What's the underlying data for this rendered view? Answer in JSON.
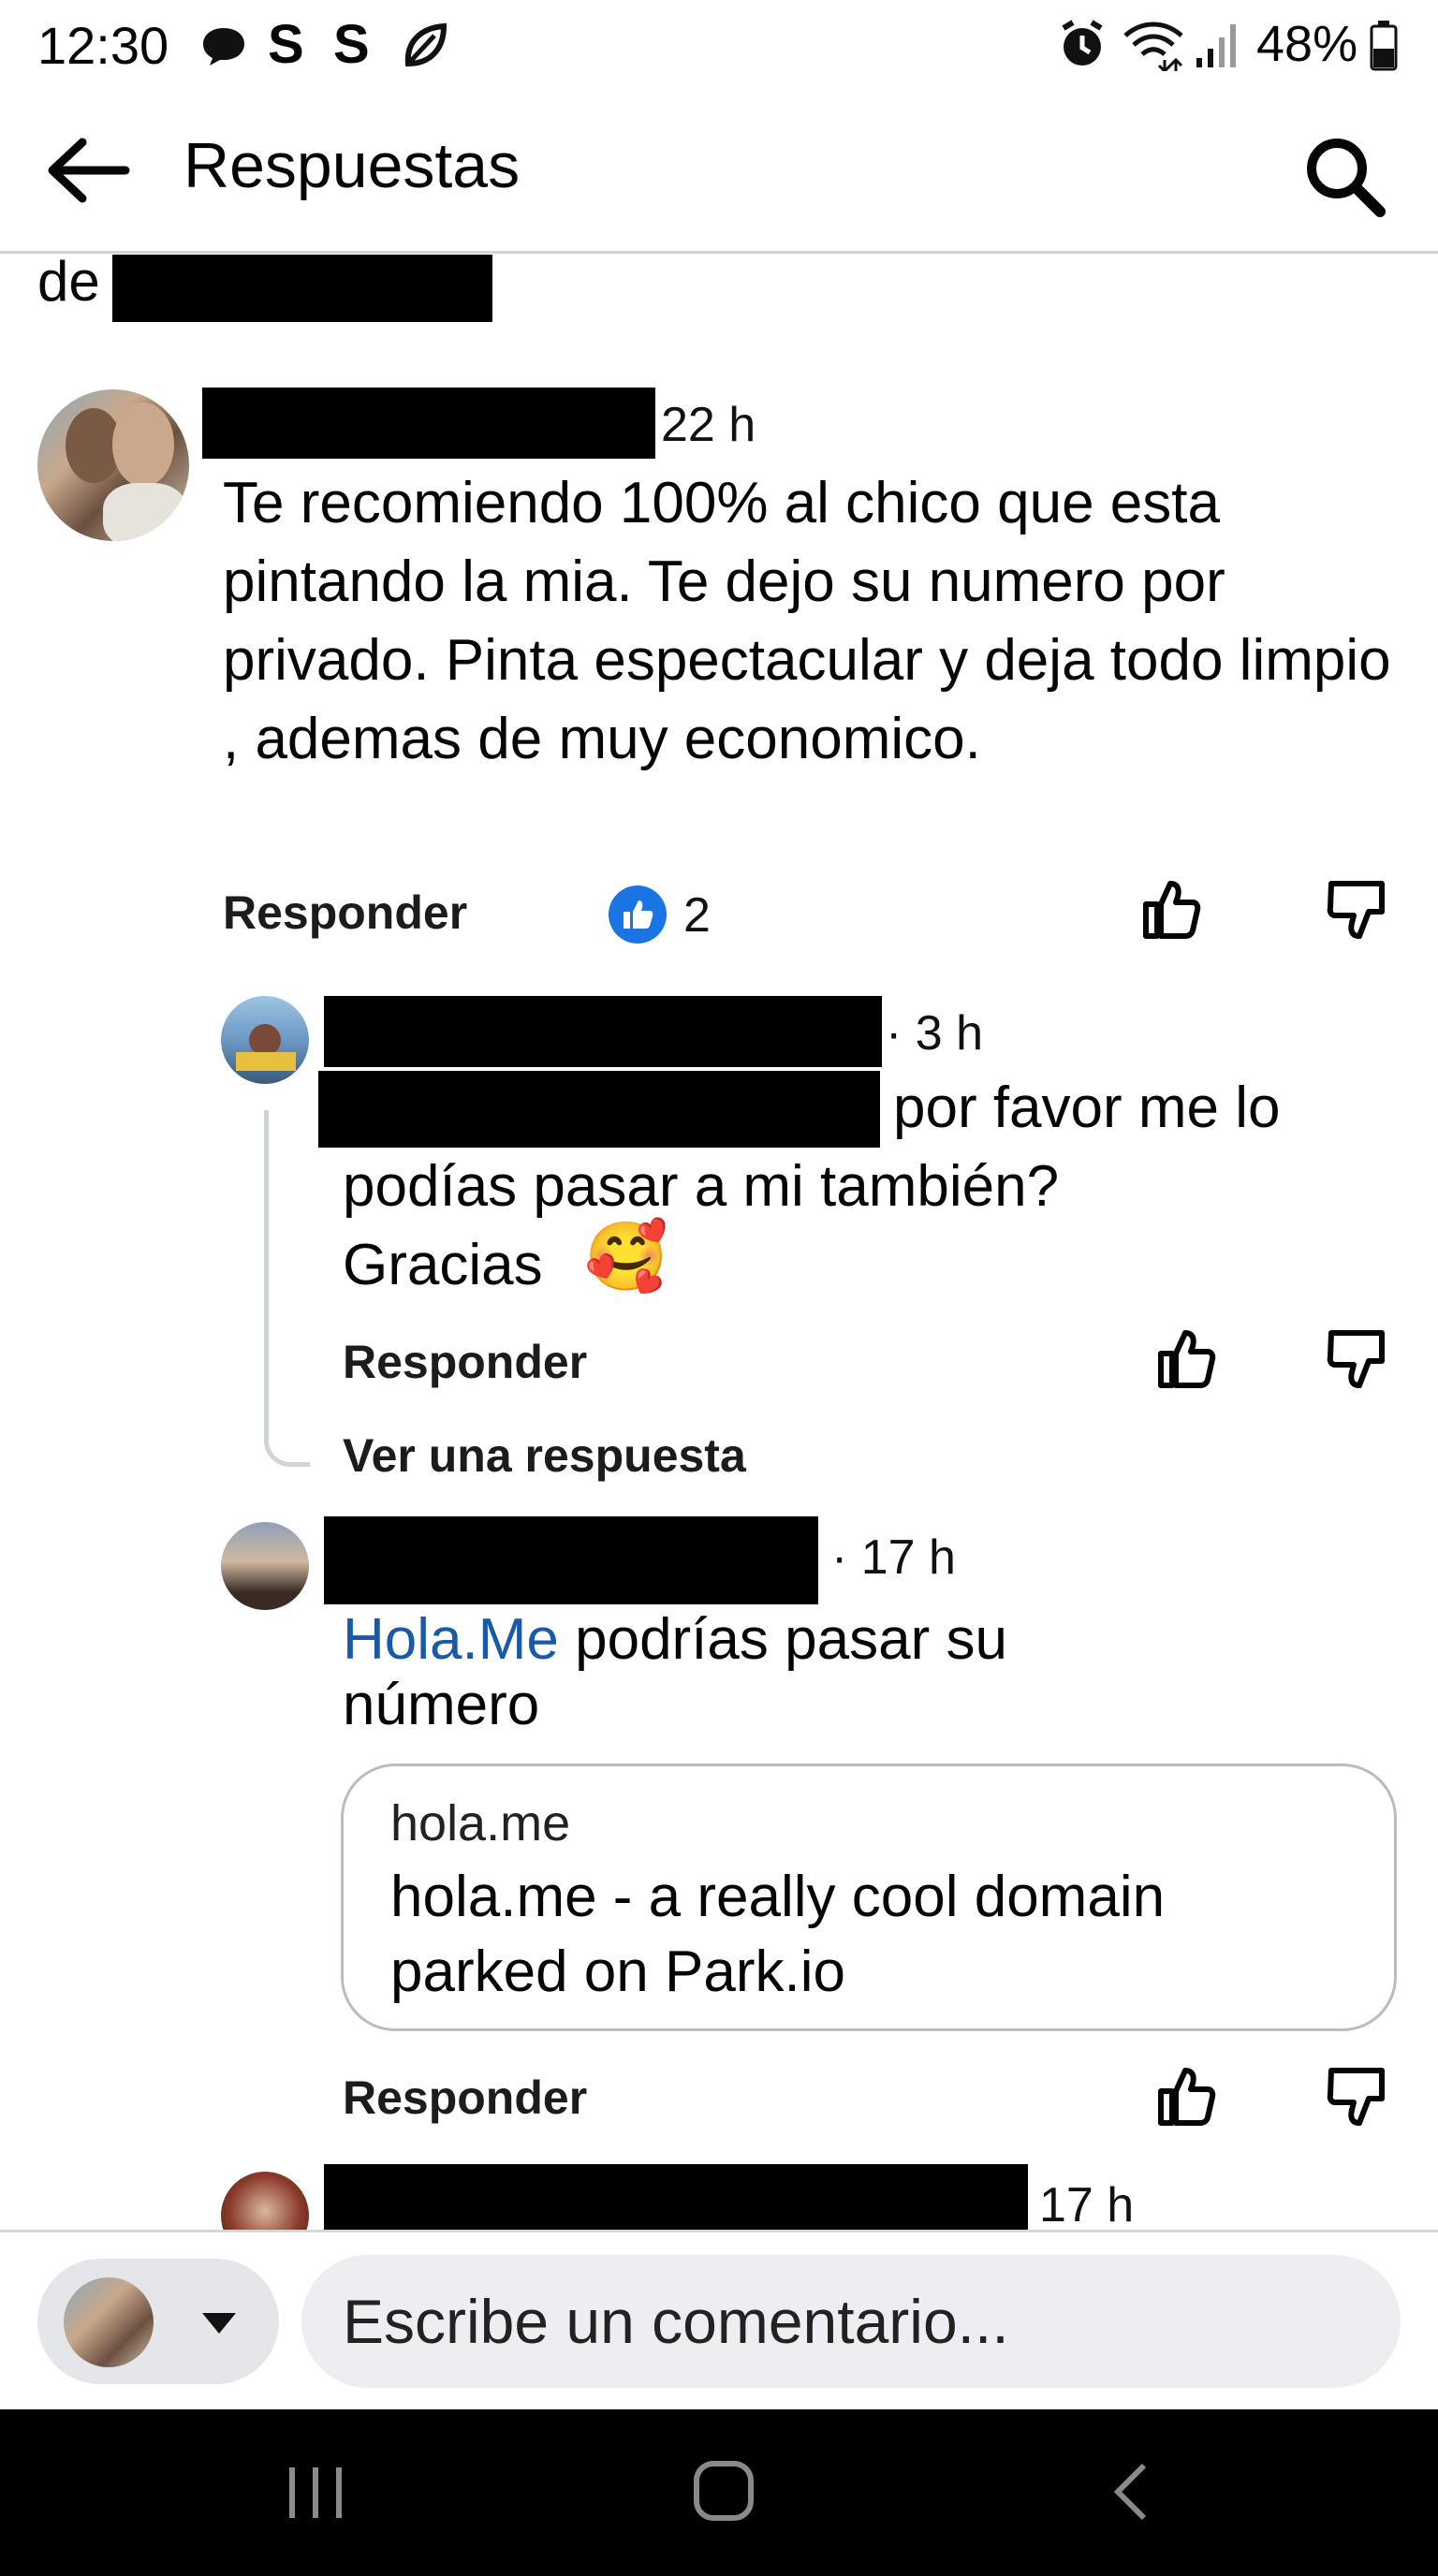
{
  "status_bar": {
    "time": "12:30",
    "icons": [
      "chat-icon",
      "s-icon",
      "s-icon",
      "leaf-icon"
    ],
    "right_icons": [
      "alarm-icon",
      "wifi-icon",
      "signal-icon",
      "battery-icon"
    ],
    "battery_percent": "48%"
  },
  "header": {
    "title": "Respuestas",
    "back_icon": "arrow-left-icon",
    "search_icon": "search-icon"
  },
  "top_fragment": {
    "text": "de"
  },
  "comments": [
    {
      "time": "22 h",
      "text": "Te recomiendo 100% al chico que esta pintando la mia. Te dejo su numero por privado. Pinta espectacular y deja todo limpio , ademas de muy economico.",
      "reply_label": "Responder",
      "reaction_count": "2"
    }
  ],
  "replies": [
    {
      "time": "· 3 h",
      "text_after_redaction": "por favor me lo",
      "text_lines": [
        "podías pasar a mi también?",
        "Gracias"
      ],
      "emoji": "🥰",
      "reply_label": "Responder",
      "view_replies": "Ver una respuesta"
    },
    {
      "time": "· 17 h",
      "mention": "Hola.Me",
      "text": " podrías  pasar  su",
      "text_line2": "número",
      "link_preview": {
        "domain": "hola.me",
        "title_line1": "hola.me - a really cool domain",
        "title_line2": "parked on Park.io"
      },
      "reply_label": "Responder"
    },
    {
      "time": "17 h"
    }
  ],
  "composer": {
    "placeholder": "Escribe un comentario..."
  },
  "colors": {
    "link": "#1a58a8",
    "like_badge": "#1b74e4",
    "composer_bg": "#edeef1",
    "nav_bar": "#000000"
  }
}
